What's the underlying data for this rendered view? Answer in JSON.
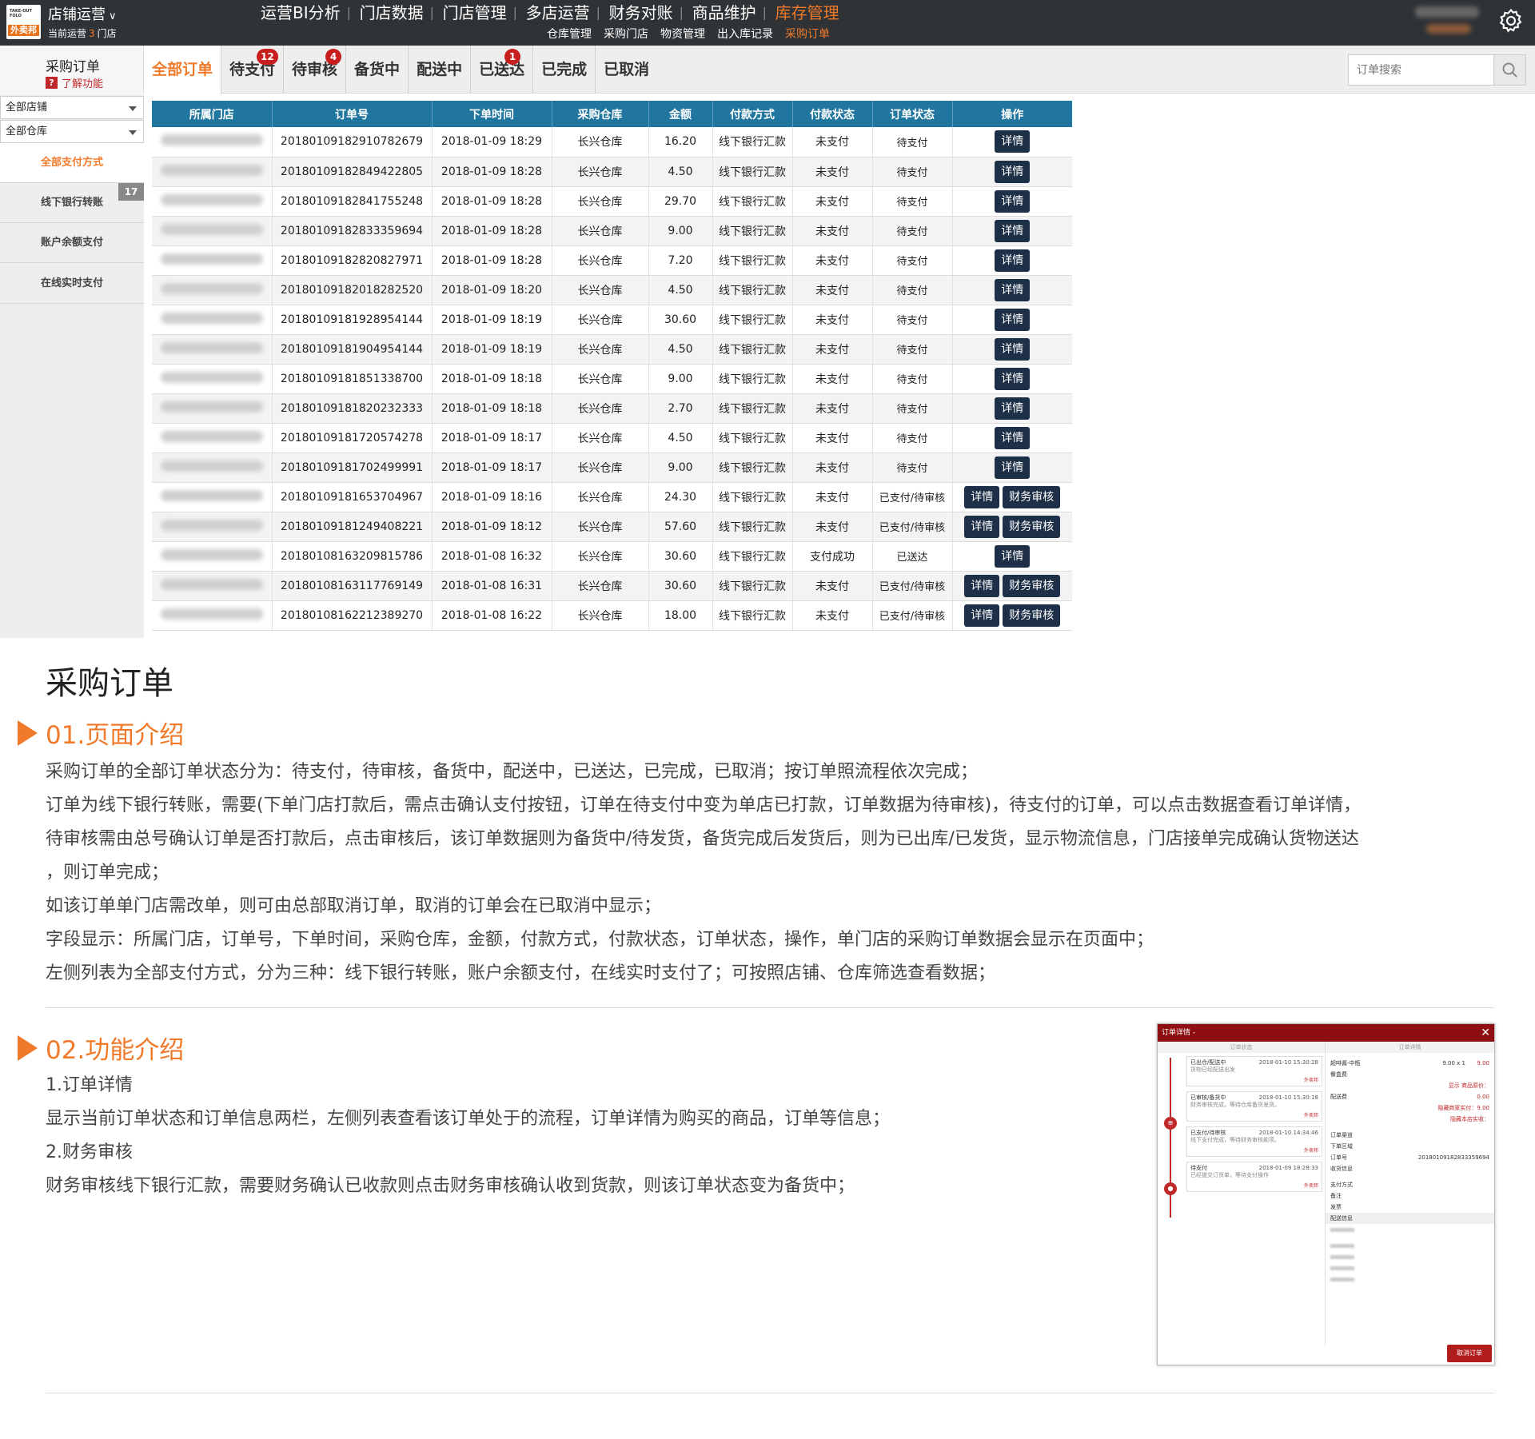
{
  "header": {
    "logo_top": "TAKE-OUT FOLO",
    "logo_brand": "外卖邦",
    "store_menu": "店铺运营",
    "store_sub_prefix": "当前运营",
    "store_count": "3",
    "store_sub_suffix": "门店",
    "nav": [
      {
        "label": "运营BI分析"
      },
      {
        "label": "门店数据"
      },
      {
        "label": "门店管理"
      },
      {
        "label": "多店运营"
      },
      {
        "label": "财务对账"
      },
      {
        "label": "商品维护"
      },
      {
        "label": "库存管理"
      }
    ],
    "subnav": [
      {
        "label": "仓库管理"
      },
      {
        "label": "采购门店"
      },
      {
        "label": "物资管理"
      },
      {
        "label": "出入库记录"
      },
      {
        "label": "采购订单"
      }
    ]
  },
  "sidebar": {
    "title": "采购订单",
    "help_label": "了解功能",
    "store_filter": "全部店铺",
    "warehouse_filter": "全部仓库",
    "payments": [
      {
        "label": "全部支付方式"
      },
      {
        "label": "线下银行转账",
        "count": "17"
      },
      {
        "label": "账户余额支付"
      },
      {
        "label": "在线实时支付"
      }
    ]
  },
  "tabs": [
    {
      "label": "全部订单"
    },
    {
      "label": "待支付",
      "badge": "12"
    },
    {
      "label": "待审核",
      "badge": "4"
    },
    {
      "label": "备货中"
    },
    {
      "label": "配送中"
    },
    {
      "label": "已送达",
      "badge": "1"
    },
    {
      "label": "已完成"
    },
    {
      "label": "已取消"
    }
  ],
  "search": {
    "placeholder": "订单搜索"
  },
  "table": {
    "headers": [
      "所属门店",
      "订单号",
      "下单时间",
      "采购仓库",
      "金额",
      "付款方式",
      "付款状态",
      "订单状态",
      "操作"
    ],
    "detail_label": "详情",
    "audit_label": "财务审核",
    "rows": [
      {
        "order_no": "20180109182910782679",
        "time": "2018-01-09 18:29",
        "warehouse": "长兴仓库",
        "amount": "16.20",
        "pay_method": "线下银行汇款",
        "pay_status": "未支付",
        "order_status": "待支付",
        "audit": false
      },
      {
        "order_no": "20180109182849422805",
        "time": "2018-01-09 18:28",
        "warehouse": "长兴仓库",
        "amount": "4.50",
        "pay_method": "线下银行汇款",
        "pay_status": "未支付",
        "order_status": "待支付",
        "audit": false
      },
      {
        "order_no": "20180109182841755248",
        "time": "2018-01-09 18:28",
        "warehouse": "长兴仓库",
        "amount": "29.70",
        "pay_method": "线下银行汇款",
        "pay_status": "未支付",
        "order_status": "待支付",
        "audit": false
      },
      {
        "order_no": "20180109182833359694",
        "time": "2018-01-09 18:28",
        "warehouse": "长兴仓库",
        "amount": "9.00",
        "pay_method": "线下银行汇款",
        "pay_status": "未支付",
        "order_status": "待支付",
        "audit": false
      },
      {
        "order_no": "20180109182820827971",
        "time": "2018-01-09 18:28",
        "warehouse": "长兴仓库",
        "amount": "7.20",
        "pay_method": "线下银行汇款",
        "pay_status": "未支付",
        "order_status": "待支付",
        "audit": false
      },
      {
        "order_no": "20180109182018282520",
        "time": "2018-01-09 18:20",
        "warehouse": "长兴仓库",
        "amount": "4.50",
        "pay_method": "线下银行汇款",
        "pay_status": "未支付",
        "order_status": "待支付",
        "audit": false
      },
      {
        "order_no": "20180109181928954144",
        "time": "2018-01-09 18:19",
        "warehouse": "长兴仓库",
        "amount": "30.60",
        "pay_method": "线下银行汇款",
        "pay_status": "未支付",
        "order_status": "待支付",
        "audit": false
      },
      {
        "order_no": "20180109181904954144",
        "time": "2018-01-09 18:19",
        "warehouse": "长兴仓库",
        "amount": "4.50",
        "pay_method": "线下银行汇款",
        "pay_status": "未支付",
        "order_status": "待支付",
        "audit": false
      },
      {
        "order_no": "20180109181851338700",
        "time": "2018-01-09 18:18",
        "warehouse": "长兴仓库",
        "amount": "9.00",
        "pay_method": "线下银行汇款",
        "pay_status": "未支付",
        "order_status": "待支付",
        "audit": false
      },
      {
        "order_no": "20180109181820232333",
        "time": "2018-01-09 18:18",
        "warehouse": "长兴仓库",
        "amount": "2.70",
        "pay_method": "线下银行汇款",
        "pay_status": "未支付",
        "order_status": "待支付",
        "audit": false
      },
      {
        "order_no": "20180109181720574278",
        "time": "2018-01-09 18:17",
        "warehouse": "长兴仓库",
        "amount": "4.50",
        "pay_method": "线下银行汇款",
        "pay_status": "未支付",
        "order_status": "待支付",
        "audit": false
      },
      {
        "order_no": "20180109181702499991",
        "time": "2018-01-09 18:17",
        "warehouse": "长兴仓库",
        "amount": "9.00",
        "pay_method": "线下银行汇款",
        "pay_status": "未支付",
        "order_status": "待支付",
        "audit": false
      },
      {
        "order_no": "20180109181653704967",
        "time": "2018-01-09 18:16",
        "warehouse": "长兴仓库",
        "amount": "24.30",
        "pay_method": "线下银行汇款",
        "pay_status": "未支付",
        "order_status": "已支付/待审核",
        "audit": true
      },
      {
        "order_no": "20180109181249408221",
        "time": "2018-01-09 18:12",
        "warehouse": "长兴仓库",
        "amount": "57.60",
        "pay_method": "线下银行汇款",
        "pay_status": "未支付",
        "order_status": "已支付/待审核",
        "audit": true
      },
      {
        "order_no": "20180108163209815786",
        "time": "2018-01-08 16:32",
        "warehouse": "长兴仓库",
        "amount": "30.60",
        "pay_method": "线下银行汇款",
        "pay_status": "支付成功",
        "order_status": "已送达",
        "audit": false
      },
      {
        "order_no": "20180108163117769149",
        "time": "2018-01-08 16:31",
        "warehouse": "长兴仓库",
        "amount": "30.60",
        "pay_method": "线下银行汇款",
        "pay_status": "未支付",
        "order_status": "已支付/待审核",
        "audit": true
      },
      {
        "order_no": "20180108162212389270",
        "time": "2018-01-08 16:22",
        "warehouse": "长兴仓库",
        "amount": "18.00",
        "pay_method": "线下银行汇款",
        "pay_status": "未支付",
        "order_status": "已支付/待审核",
        "audit": true
      }
    ]
  },
  "doc": {
    "title": "采购订单",
    "section1_title": "01.页面介绍",
    "section1_lines": [
      "采购订单的全部订单状态分为：待支付，待审核，备货中，配送中，已送达，已完成，已取消；按订单照流程依次完成；",
      "订单为线下银行转账，需要(下单门店打款后，需点击确认支付按钮，订单在待支付中变为单店已打款，订单数据为待审核)，待支付的订单，可以点击数据查看订单详情，",
      "待审核需由总号确认订单是否打款后，点击审核后，该订单数据则为备货中/待发货，备货完成后发货后，则为已出库/已发货，显示物流信息，门店接单完成确认货物送达",
      "，则订单完成；",
      "如该订单单门店需改单，则可由总部取消订单，取消的订单会在已取消中显示；",
      "字段显示：所属门店，订单号，下单时间，采购仓库，金额，付款方式，付款状态，订单状态，操作，单门店的采购订单数据会显示在页面中；",
      "左侧列表为全部支付方式，分为三种：线下银行转账，账户余额支付，在线实时支付了；可按照店铺、仓库筛选查看数据；"
    ],
    "section2_title": "02.功能介绍",
    "section2_lines": [
      "1.订单详情",
      "显示当前订单状态和订单信息两栏，左侧列表查看该订单处于的流程，订单详情为购买的商品，订单等信息；",
      "2.财务审核",
      "财务审核线下银行汇款，需要财务确认已收款则点击财务审核确认收到货款，则该订单状态变为备货中；"
    ]
  },
  "modal": {
    "title": "订单详情 -",
    "left_header": "订单状态",
    "right_header": "订单详情",
    "timeline": [
      {
        "status": "已出仓/配送中",
        "time": "2018-01-10 15:30:28",
        "desc": "货物已经配送出发",
        "who": "外卖邦"
      },
      {
        "status": "已审核/备货中",
        "time": "2018-01-10 15:30:18",
        "desc": "财务审核完成，等待仓库备货发货。",
        "who": "外卖邦"
      },
      {
        "status": "已支付/待审核",
        "time": "2018-01-10 14:34:46",
        "desc": "线下支付完成，等待财务审核款项。",
        "who": "外卖邦"
      },
      {
        "status": "待支付",
        "time": "2018-01-09 18:28:33",
        "desc": "已经提交订货单，等待支付操作",
        "who": "外卖邦"
      }
    ],
    "item_name": "超啡酱-中瓶",
    "item_qty": "9.00 x 1",
    "item_price": "9.00",
    "pack_label": "餐盒费",
    "show_price_label": "显示 商品原价：",
    "delivery_label": "配送费",
    "delivery_value": "0.00",
    "hidden_paid_label": "隐藏商家实付：9.00",
    "hidden_store_label": "隐藏本店实收：",
    "info_rows": [
      "订单渠道",
      "下单区域",
      "订单号",
      "收货信息"
    ],
    "order_no": "20180109182833359694",
    "pay_rows": [
      "支付方式",
      "备注",
      "发票"
    ],
    "delivery_info": "配送信息",
    "cancel_label": "取消订单"
  }
}
